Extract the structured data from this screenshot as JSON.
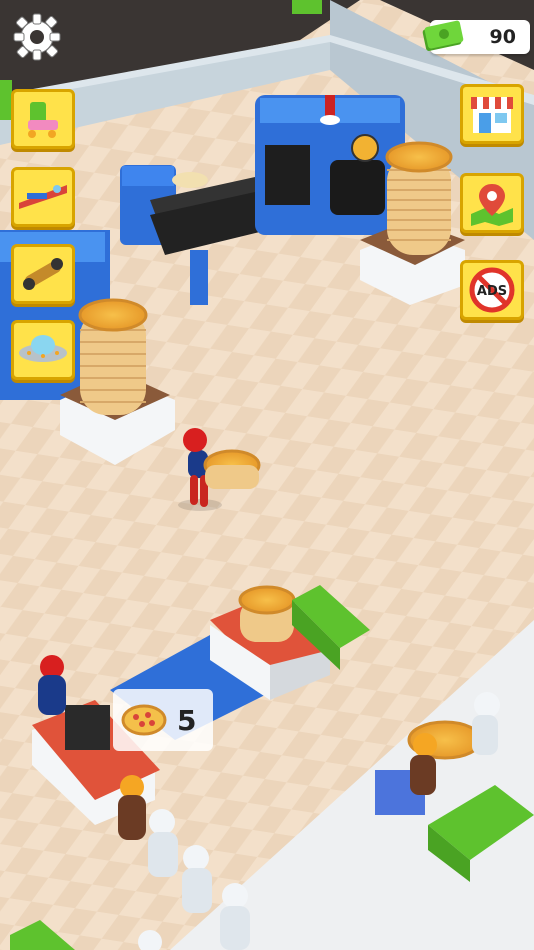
{
  "hud": {
    "money_value": "90",
    "settings_icon": "gear-icon",
    "cash_icon": "cash-icon"
  },
  "left_menu": {
    "items": [
      {
        "icon": "roller-skates-icon"
      },
      {
        "icon": "hoverboard-sled-icon"
      },
      {
        "icon": "hoverboard-icon"
      },
      {
        "icon": "ufo-icon"
      }
    ]
  },
  "right_menu": {
    "items": [
      {
        "icon": "shop-icon"
      },
      {
        "icon": "map-pin-icon"
      },
      {
        "icon": "no-ads-icon",
        "label": "ADS"
      }
    ]
  },
  "counter": {
    "pizza_count": "5",
    "icon": "pizza-icon"
  },
  "colors": {
    "floor": "#f1dcc4",
    "wall": "#c7d4dc",
    "machine_blue": "#2f6fd8",
    "counter_red": "#e0533a",
    "money_green": "#5ec22e",
    "button_yellow": "#ffe24a"
  }
}
